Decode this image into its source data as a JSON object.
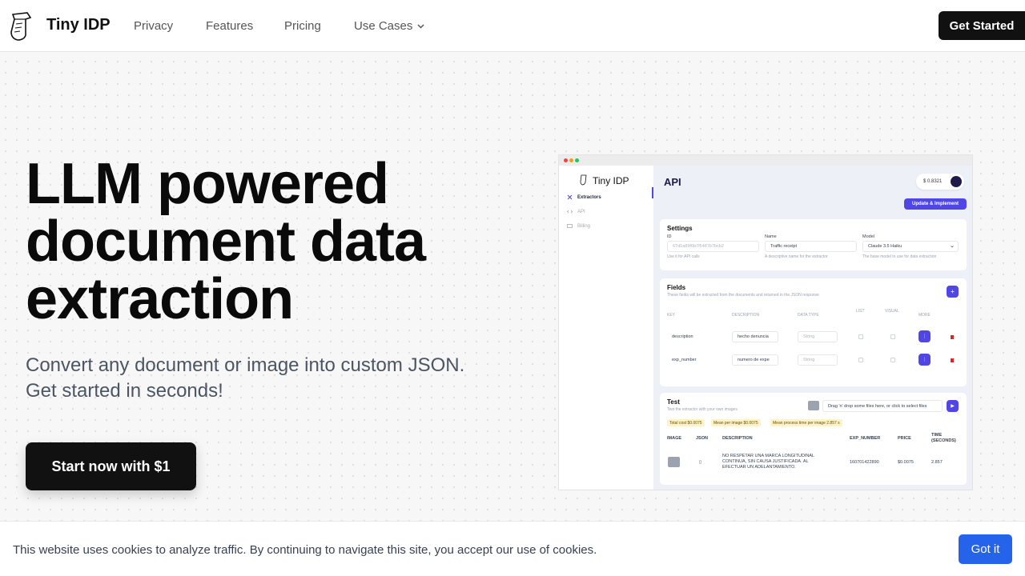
{
  "nav": {
    "brand": "Tiny IDP",
    "links": [
      "Privacy",
      "Features",
      "Pricing",
      "Use Cases"
    ],
    "cta": "Get Started"
  },
  "hero": {
    "title_lines": [
      "LLM powered",
      "document data",
      "extraction"
    ],
    "subtitle_lines": [
      "Convert any document or image into custom JSON.",
      "Get started in seconds!"
    ],
    "cta": "Start now with $1"
  },
  "preview": {
    "brand": "Tiny IDP",
    "sidebar": [
      "Extractors",
      "API",
      "Billing"
    ],
    "page_title": "API",
    "balance": "$ 0.8321",
    "update_button": "Update & Implement",
    "settings": {
      "heading": "Settings",
      "id_label": "ID",
      "id_value": "67d1a89f6b7f5487b7bcb2",
      "id_help": "Use it for API calls",
      "name_label": "Name",
      "name_value": "Traffic receipt",
      "name_help": "A descriptive name for the extractor",
      "model_label": "Model",
      "model_value": "Claude 3.5 Haiku",
      "model_help": "The base model to use for data extraction"
    },
    "fields": {
      "heading": "Fields",
      "help": "These fields will be extracted from the documents and returned in the JSON response",
      "columns": [
        "KEY",
        "DESCRIPTION",
        "DATA TYPE",
        "LIST",
        "VISUAL",
        "MORE"
      ],
      "rows": [
        {
          "key": "description",
          "desc": "hecho denuncia",
          "type": "String"
        },
        {
          "key": "exp_number",
          "desc": "numero de expe",
          "type": "String"
        }
      ]
    },
    "test": {
      "heading": "Test",
      "help": "Test the extractor with your own images",
      "dropzone": "Drag 'n' drop some files here, or click to select files",
      "stats": [
        {
          "label": "Total cost",
          "value": "$0.0075"
        },
        {
          "label": "Mean per image",
          "value": "$0.0075"
        },
        {
          "label": "Mean process time per image",
          "value": "2.857 s"
        }
      ],
      "columns": [
        "IMAGE",
        "JSON",
        "DESCRIPTION",
        "EXP_NUMBER",
        "PRICE",
        "TIME (SECONDS)"
      ],
      "row": {
        "description": "NO RESPETAR UNA MARCA LONGITUDINAL CONTINUA, SIN CAUSA JUSTIFICADA. AL EFECTUAR UN ADELANTAMIENTO.",
        "exp_number": "160701422890",
        "price": "$0.0075",
        "time": "2.857"
      }
    }
  },
  "cookie": {
    "text": "This website uses cookies to analyze traffic. By continuing to navigate this site, you accept our use of cookies.",
    "button": "Got it"
  },
  "colors": {
    "accent": "#4f46e5",
    "cookie_button": "#2563eb",
    "dark": "#111111"
  }
}
